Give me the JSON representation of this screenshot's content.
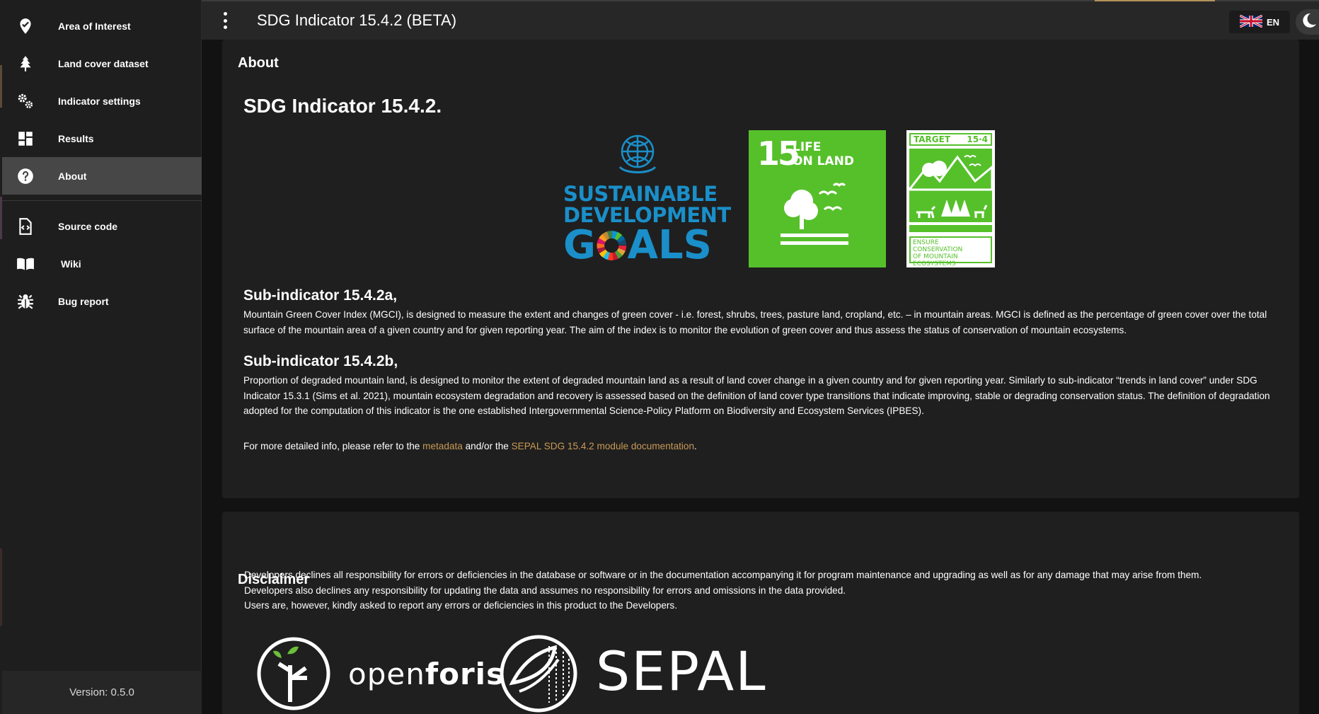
{
  "window": {
    "title": "SDG Indicator 15.4.2 (BETA)"
  },
  "sidebar": {
    "items": [
      {
        "label": "Area of Interest",
        "icon": "map-marker-check-icon"
      },
      {
        "label": "Land cover dataset",
        "icon": "tree-icon"
      },
      {
        "label": "Indicator settings",
        "icon": "cogs-icon"
      },
      {
        "label": "Results",
        "icon": "dashboard-icon"
      },
      {
        "label": "About",
        "icon": "question-circle-icon",
        "active": true
      },
      {
        "label": "Source code",
        "icon": "code-file-icon"
      },
      {
        "label": "Wiki",
        "icon": "book-open-icon"
      },
      {
        "label": "Bug report",
        "icon": "bug-icon"
      }
    ],
    "version": "Version: 0.5.0"
  },
  "topbar": {
    "language": "EN",
    "language_icon": "uk-flag-icon",
    "theme_icon": "moon-icon"
  },
  "about": {
    "section_title": "About",
    "heading": "SDG Indicator 15.4.2.",
    "logos": {
      "sdg": {
        "line1": "SUSTAINABLE",
        "line2": "DEVELOPMENT",
        "line3a": "G",
        "line3b": "ALS"
      },
      "goal15": {
        "number": "15",
        "line1": "LIFE",
        "line2": "ON LAND"
      },
      "target": {
        "label": "TARGET",
        "number": "15·4",
        "text1": "ENSURE CONSERVATION",
        "text2": "OF MOUNTAIN",
        "text3": "ECOSYSTEMS"
      }
    },
    "sub_a": {
      "title": "Sub-indicator 15.4.2a,",
      "text": "Mountain Green Cover Index (MGCI), is designed to measure the extent and changes of green cover - i.e. forest, shrubs, trees, pasture land, cropland, etc. – in mountain areas. MGCI is defined as the percentage of green cover over the total surface of the mountain area of a given country and for given reporting year. The aim of the index is to monitor the evolution of green cover and thus assess the status of conservation of mountain ecosystems."
    },
    "sub_b": {
      "title": "Sub-indicator 15.4.2b,",
      "text": "Proportion of degraded mountain land, is designed to monitor the extent of degraded mountain land as a result of land cover change in a given country and for given reporting year. Similarly to sub-indicator “trends in land cover” under SDG Indicator 15.3.1 (Sims et al. 2021), mountain ecosystem degradation and recovery is assessed based on the definition of land cover type transitions that indicate improving, stable or degrading conservation status. The definition of degradation adopted for the computation of this indicator is the one established Intergovernmental Science-Policy Platform on Biodiversity and Ecosystem Services (IPBES)."
    },
    "more_info": {
      "prefix": "For more detailed info, please refer to the ",
      "link1": "metadata",
      "middle": " and/or the ",
      "link2": "SEPAL SDG 15.4.2 module documentation",
      "suffix": "."
    }
  },
  "disclaimer": {
    "section_title": "Disclaimer",
    "lines": [
      "Developers declines all responsibility for errors or deficiencies in the database or software or in the documentation accompanying it for program maintenance and upgrading as well as for any damage that may arise from them.",
      "Developers also declines any responsibility for updating the data and assumes no responsibility for errors and omissions in the data provided.",
      "Users are, however, kindly asked to report any errors or deficiencies in this product to the Developers."
    ],
    "logos": {
      "openforis_a": "open",
      "openforis_b": "foris",
      "sepal": "SEPAL"
    }
  }
}
